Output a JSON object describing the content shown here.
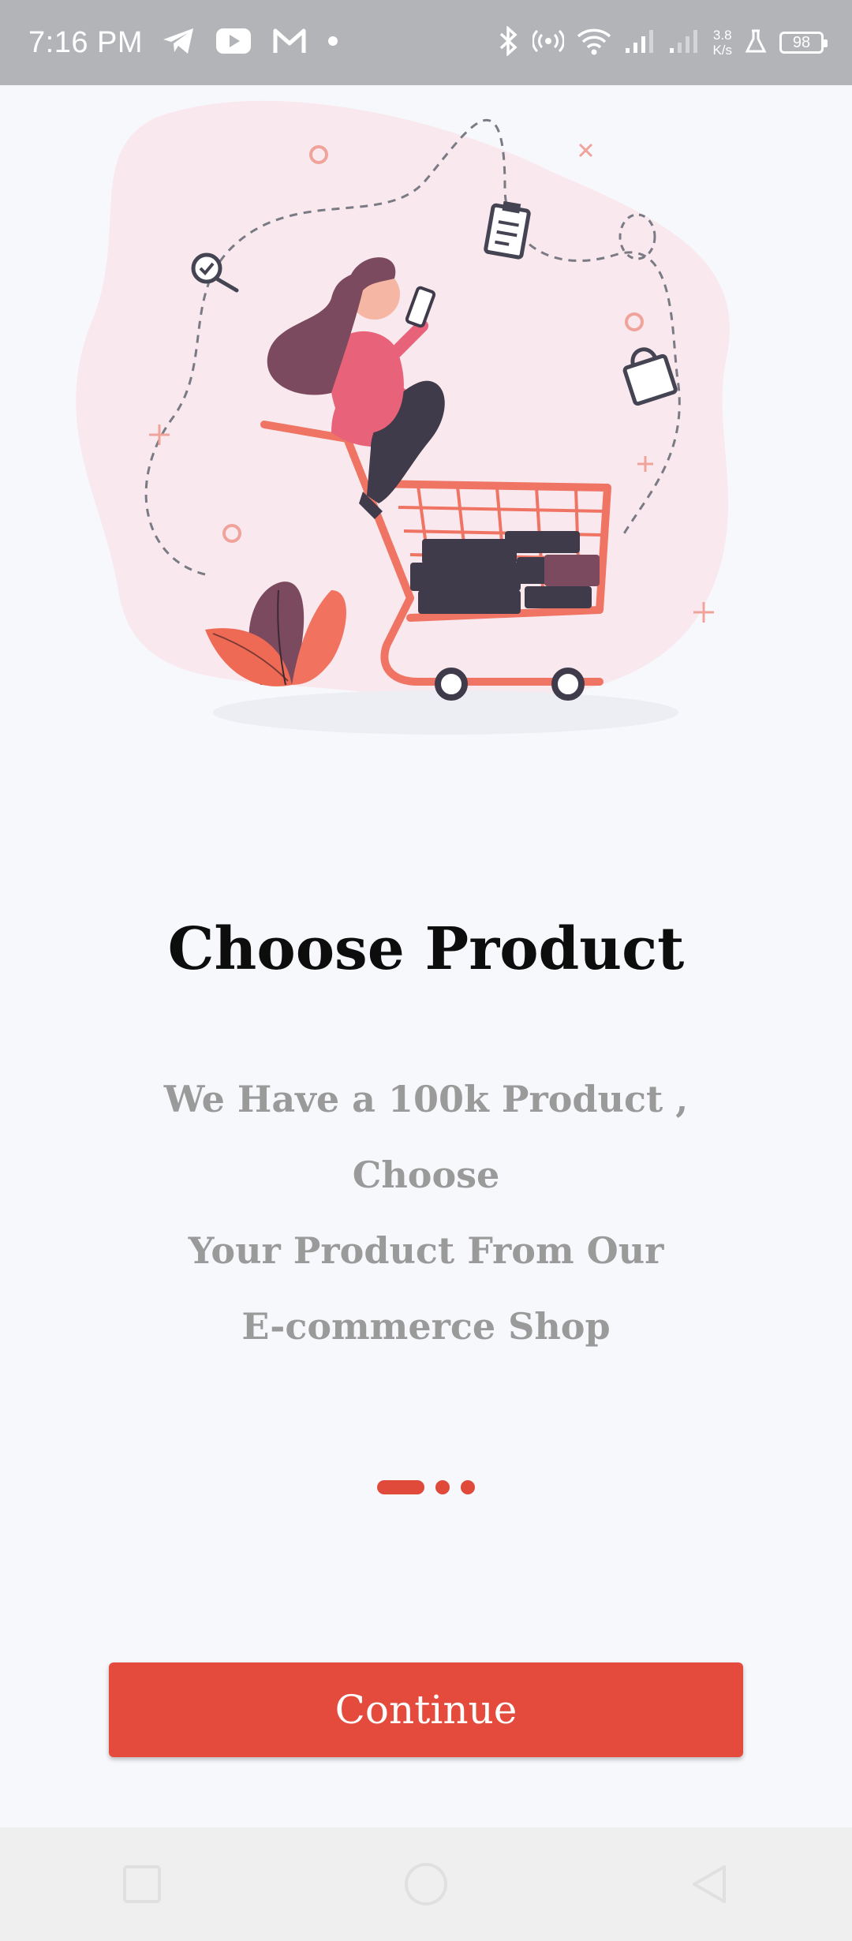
{
  "status_bar": {
    "time": "7:16 PM",
    "net_speed_value": "3.8",
    "net_speed_unit": "K/s",
    "battery": "98",
    "icons": [
      "telegram-icon",
      "youtube-icon",
      "gmail-icon",
      "dot-icon",
      "bluetooth-icon",
      "hotspot-icon",
      "wifi-icon",
      "signal-icon",
      "signal-icon-2",
      "lab-icon",
      "battery-icon"
    ]
  },
  "onboarding": {
    "title": "Choose Product",
    "description": "We Have a 100k Product , Choose\nYour Product From  Our\nE-commerce Shop",
    "pages_total": 3,
    "current_page": 1,
    "continue_label": "Continue"
  },
  "colors": {
    "accent": "#e54b3c",
    "background": "#f7f8fc",
    "status_bar": "#b3b4b8",
    "description_text": "#9a9a9a"
  },
  "nav_bar": {
    "buttons": [
      "recents-button",
      "home-button",
      "back-button"
    ]
  }
}
